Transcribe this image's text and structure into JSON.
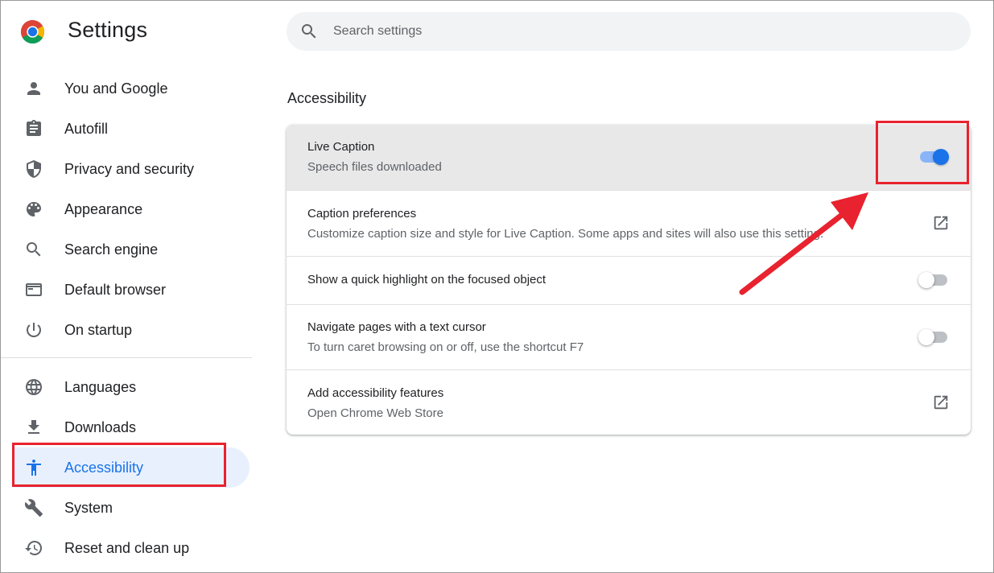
{
  "app": {
    "title": "Settings",
    "logo_icon": "chrome-logo-icon"
  },
  "search": {
    "placeholder": "Search settings",
    "value": "",
    "icon": "search-icon"
  },
  "sidebar": {
    "items": [
      {
        "label": "You and Google",
        "icon": "person-icon",
        "active": false
      },
      {
        "label": "Autofill",
        "icon": "clipboard-icon",
        "active": false
      },
      {
        "label": "Privacy and security",
        "icon": "shield-icon",
        "active": false
      },
      {
        "label": "Appearance",
        "icon": "palette-icon",
        "active": false
      },
      {
        "label": "Search engine",
        "icon": "search-icon",
        "active": false
      },
      {
        "label": "Default browser",
        "icon": "browser-window-icon",
        "active": false
      },
      {
        "label": "On startup",
        "icon": "power-icon",
        "active": false
      },
      {
        "label": "Languages",
        "icon": "globe-icon",
        "active": false
      },
      {
        "label": "Downloads",
        "icon": "download-icon",
        "active": false
      },
      {
        "label": "Accessibility",
        "icon": "accessibility-icon",
        "active": true
      },
      {
        "label": "System",
        "icon": "wrench-icon",
        "active": false
      },
      {
        "label": "Reset and clean up",
        "icon": "history-icon",
        "active": false
      }
    ]
  },
  "main": {
    "section_title": "Accessibility",
    "rows": [
      {
        "title": "Live Caption",
        "subtitle": "Speech files downloaded",
        "control": "toggle",
        "on": true
      },
      {
        "title": "Caption preferences",
        "subtitle": "Customize caption size and style for Live Caption. Some apps and sites will also use this setting.",
        "control": "external-link",
        "icon": "open-in-new-icon"
      },
      {
        "title": "Show a quick highlight on the focused object",
        "subtitle": "",
        "control": "toggle",
        "on": false
      },
      {
        "title": "Navigate pages with a text cursor",
        "subtitle": "To turn caret browsing on or off, use the shortcut F7",
        "control": "toggle",
        "on": false
      },
      {
        "title": "Add accessibility features",
        "subtitle": "Open Chrome Web Store",
        "control": "external-link",
        "icon": "open-in-new-icon"
      }
    ]
  },
  "colors": {
    "accent": "#1a73e8",
    "active_bg": "#e8f0fe",
    "annotation": "#e8222e"
  }
}
